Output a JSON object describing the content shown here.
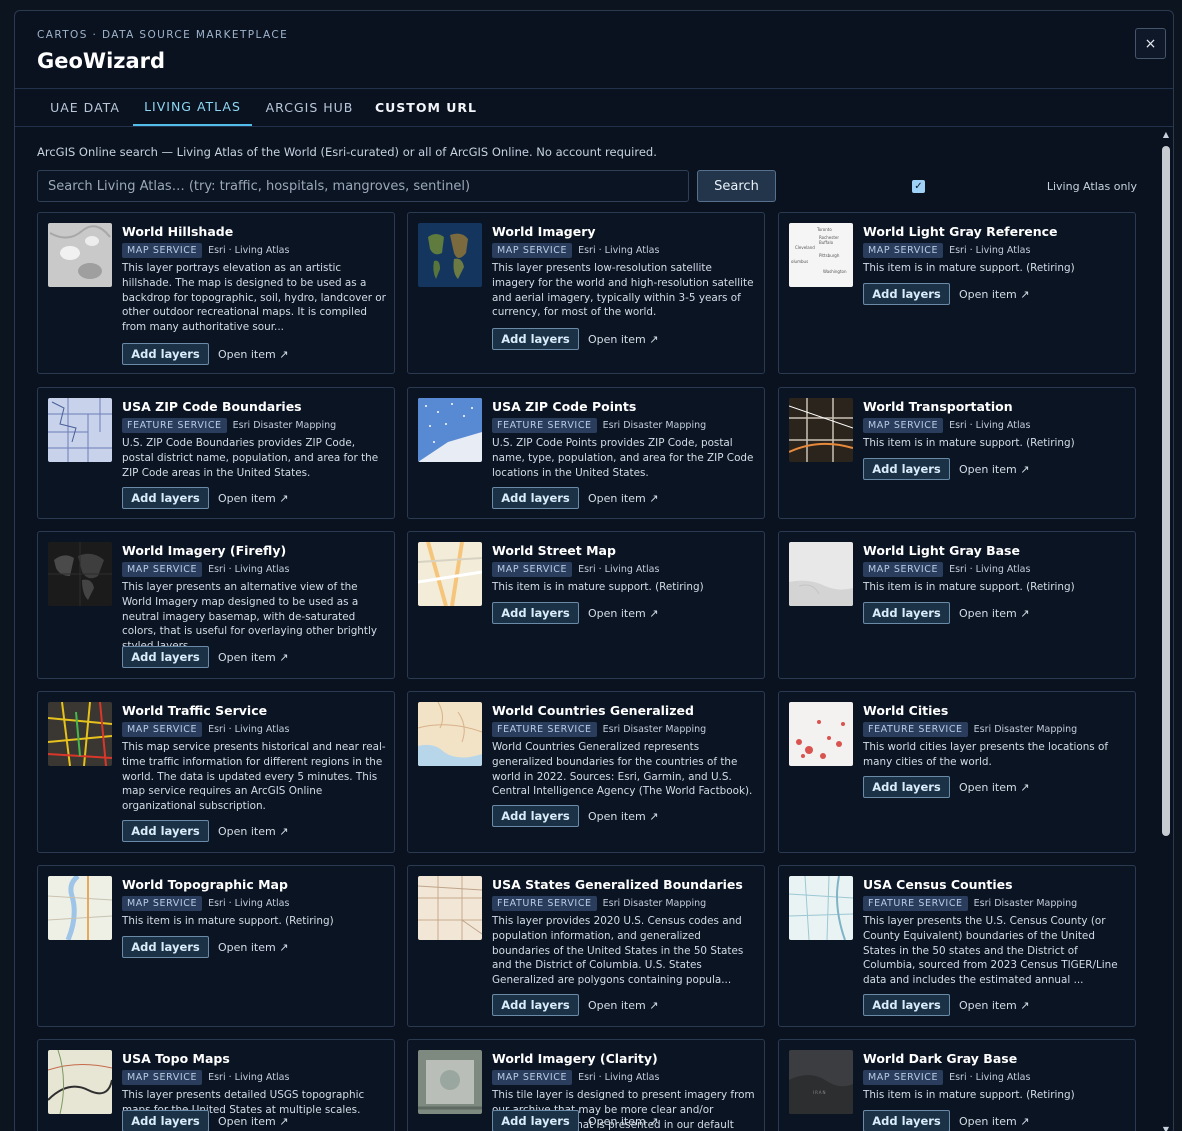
{
  "app": {
    "eyebrow": "CARTOS · DATA SOURCE MARKETPLACE",
    "title": "GeoWizard",
    "close_icon": "×"
  },
  "tabs": [
    {
      "label": "UAE DATA",
      "state": "inactive"
    },
    {
      "label": "LIVING ATLAS",
      "state": "active"
    },
    {
      "label": "ARCGIS HUB",
      "state": "inactive"
    },
    {
      "label": "CUSTOM URL",
      "state": "bold"
    }
  ],
  "search": {
    "description": "ArcGIS Online search — Living Atlas of the World (Esri-curated) or all of ArcGIS Online. No account required.",
    "placeholder": "Search Living Atlas… (try: traffic, hospitals, mangroves, sentinel)",
    "value": "",
    "button_label": "Search",
    "living_atlas_only_label": "Living Atlas only",
    "living_atlas_only_checked": true,
    "check_glyph": "✓"
  },
  "colors": {
    "accent": "#52bde8",
    "background": "#0a1220",
    "card_border": "#2a3a51",
    "badge_bg": "#2a3d5c"
  },
  "actions": {
    "add_label": "Add layers",
    "open_label": "Open item ↗"
  },
  "results": [
    {
      "title": "World Hillshade",
      "type": "MAP SERVICE",
      "owner": "Esri · Living Atlas",
      "snippet": "This layer portrays elevation as an artistic hillshade. The map is designed to be used as a backdrop for topographic, soil, hydro, landcover or other outdoor recreational maps. It is compiled from many authoritative sour...",
      "thumb": "hillshade"
    },
    {
      "title": "World Imagery",
      "type": "MAP SERVICE",
      "owner": "Esri · Living Atlas",
      "snippet": "This layer presents low-resolution satellite imagery for the world and high-resolution satellite and aerial imagery, typically within 3-5 years of currency, for most of the world.",
      "thumb": "imagery"
    },
    {
      "title": "World Light Gray Reference",
      "type": "MAP SERVICE",
      "owner": "Esri · Living Atlas",
      "snippet": "This item is in mature support. (Retiring)",
      "thumb": "lightgrayref"
    },
    {
      "title": "USA ZIP Code Boundaries",
      "type": "FEATURE SERVICE",
      "owner": "Esri Disaster Mapping",
      "snippet": "U.S. ZIP Code Boundaries provides ZIP Code, postal district name, population, and area for the ZIP Code areas in the United States.",
      "thumb": "zipbounds"
    },
    {
      "title": "USA ZIP Code Points",
      "type": "FEATURE SERVICE",
      "owner": "Esri Disaster Mapping",
      "snippet": "U.S. ZIP Code Points provides ZIP Code, postal name, type, population, and area for the ZIP Code locations in the United States.",
      "thumb": "zippoints"
    },
    {
      "title": "World Transportation",
      "type": "MAP SERVICE",
      "owner": "Esri · Living Atlas",
      "snippet": "This item is in mature support. (Retiring)",
      "thumb": "transport"
    },
    {
      "title": "World Imagery (Firefly)",
      "type": "MAP SERVICE",
      "owner": "Esri · Living Atlas",
      "snippet": "This layer presents an alternative view of the World Imagery map designed to be used as a neutral imagery basemap, with de-saturated colors, that is useful for overlaying other brightly styled layers.",
      "thumb": "firefly"
    },
    {
      "title": "World Street Map",
      "type": "MAP SERVICE",
      "owner": "Esri · Living Atlas",
      "snippet": "This item is in mature support. (Retiring)",
      "thumb": "street"
    },
    {
      "title": "World Light Gray Base",
      "type": "MAP SERVICE",
      "owner": "Esri · Living Atlas",
      "snippet": "This item is in mature support. (Retiring)",
      "thumb": "lightgraybase"
    },
    {
      "title": "World Traffic Service",
      "type": "MAP SERVICE",
      "owner": "Esri · Living Atlas",
      "snippet": "This map service presents historical and near real-time traffic information for different regions in the world. The data is updated every 5 minutes. This map service requires an ArcGIS Online organizational subscription.",
      "thumb": "traffic"
    },
    {
      "title": "World Countries Generalized",
      "type": "FEATURE SERVICE",
      "owner": "Esri Disaster Mapping",
      "snippet": "World Countries Generalized represents generalized boundaries for the countries of the world in 2022. Sources: Esri, Garmin, and U.S. Central Intelligence Agency (The World Factbook).",
      "thumb": "countries"
    },
    {
      "title": "World Cities",
      "type": "FEATURE SERVICE",
      "owner": "Esri Disaster Mapping",
      "snippet": "This world cities layer presents the locations of many cities of the world.",
      "thumb": "cities"
    },
    {
      "title": "World Topographic Map",
      "type": "MAP SERVICE",
      "owner": "Esri · Living Atlas",
      "snippet": "This item is in mature support. (Retiring)",
      "thumb": "topo"
    },
    {
      "title": "USA States Generalized Boundaries",
      "type": "FEATURE SERVICE",
      "owner": "Esri Disaster Mapping",
      "snippet": "This layer provides 2020 U.S. Census codes and population information, and generalized boundaries of the United States in the 50 States and the District of Columbia. U.S. States Generalized are polygons containing popula...",
      "thumb": "states"
    },
    {
      "title": "USA Census Counties",
      "type": "FEATURE SERVICE",
      "owner": "Esri Disaster Mapping",
      "snippet": "This layer presents the U.S. Census County (or County Equivalent) boundaries of the United States in the 50 states and the District of Columbia, sourced from 2023 Census TIGER/Line data and includes the estimated annual ...",
      "thumb": "counties"
    },
    {
      "title": "USA Topo Maps",
      "type": "MAP SERVICE",
      "owner": "Esri · Living Atlas",
      "snippet": "This layer presents detailed USGS topographic maps for the United States at multiple scales. (Retiring)",
      "thumb": "usatopo"
    },
    {
      "title": "World Imagery (Clarity)",
      "type": "MAP SERVICE",
      "owner": "Esri · Living Atlas",
      "snippet": "This tile layer is designed to present imagery from our archive that may be more clear and/or accurate than what is presented in our default World Imagery map.",
      "thumb": "clarity"
    },
    {
      "title": "World Dark Gray Base",
      "type": "MAP SERVICE",
      "owner": "Esri · Living Atlas",
      "snippet": "This item is in mature support. (Retiring)",
      "thumb": "darkgray"
    }
  ]
}
